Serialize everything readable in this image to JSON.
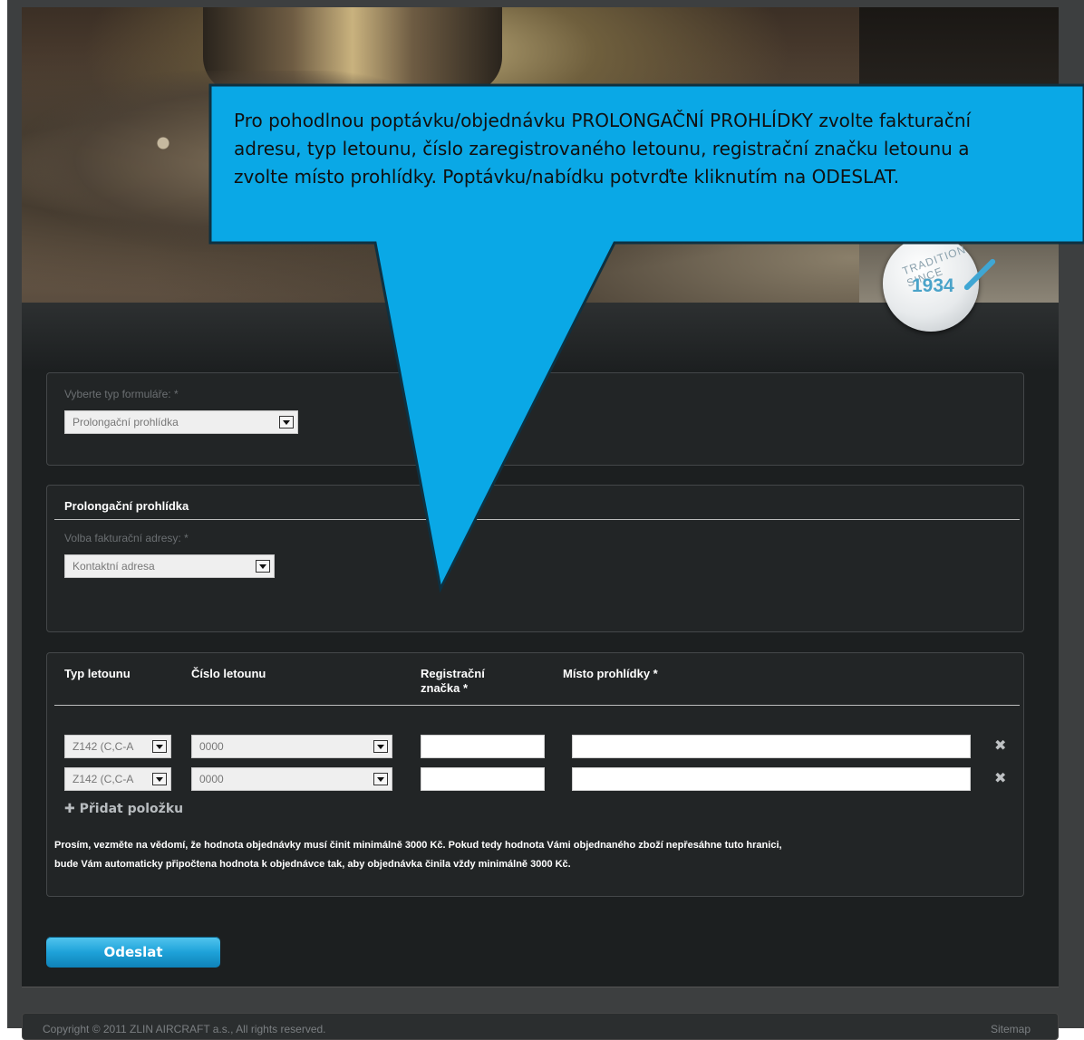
{
  "hero": {
    "badge_text": "TRADITION SINCE",
    "badge_year": "1934"
  },
  "form_type": {
    "label": "Vyberte typ formuláře: *",
    "selected": "Prolongační prohlídka"
  },
  "inspection": {
    "title": "Prolongační prohlídka",
    "billing_label": "Volba fakturační adresy: *",
    "billing_selected": "Kontaktní adresa"
  },
  "table": {
    "headers": {
      "type": "Typ letounu",
      "number": "Číslo letounu",
      "registration": "Registrační značka *",
      "place": "Místo prohlídky *"
    },
    "rows": [
      {
        "type": "Z142 (C,C-A",
        "number": "0000",
        "registration": "",
        "place": ""
      },
      {
        "type": "Z142 (C,C-A",
        "number": "0000",
        "registration": "",
        "place": ""
      }
    ],
    "add_item": "Přidat položku",
    "remove_glyph": "✖"
  },
  "note": {
    "line1": "Prosím, vezměte na vědomí, že hodnota objednávky musí činit minimálně 3000 Kč. Pokud tedy hodnota Vámi objednaného zboží nepřesáhne tuto hranici,",
    "line2": "bude Vám automaticky připočtena hodnota k objednávce tak, aby objednávka činila vždy minimálně 3000 Kč."
  },
  "submit_label": "Odeslat",
  "footer": {
    "copyright": "Copyright © 2011 ZLIN AIRCRAFT a.s., All rights reserved.",
    "sitemap": "Sitemap"
  },
  "callout": {
    "line1": "Pro pohodlnou poptávku/objednávku PROLONGAČNÍ PROHLÍDKY zvolte fakturační",
    "line2": "adresu, typ letounu, číslo zaregistrovaného letounu, registrační značku letounu a",
    "line3": "zvolte místo prohlídky. Poptávku/nabídku potvrďte kliknutím na ODESLAT.",
    "fill": "#0aa8e6"
  }
}
